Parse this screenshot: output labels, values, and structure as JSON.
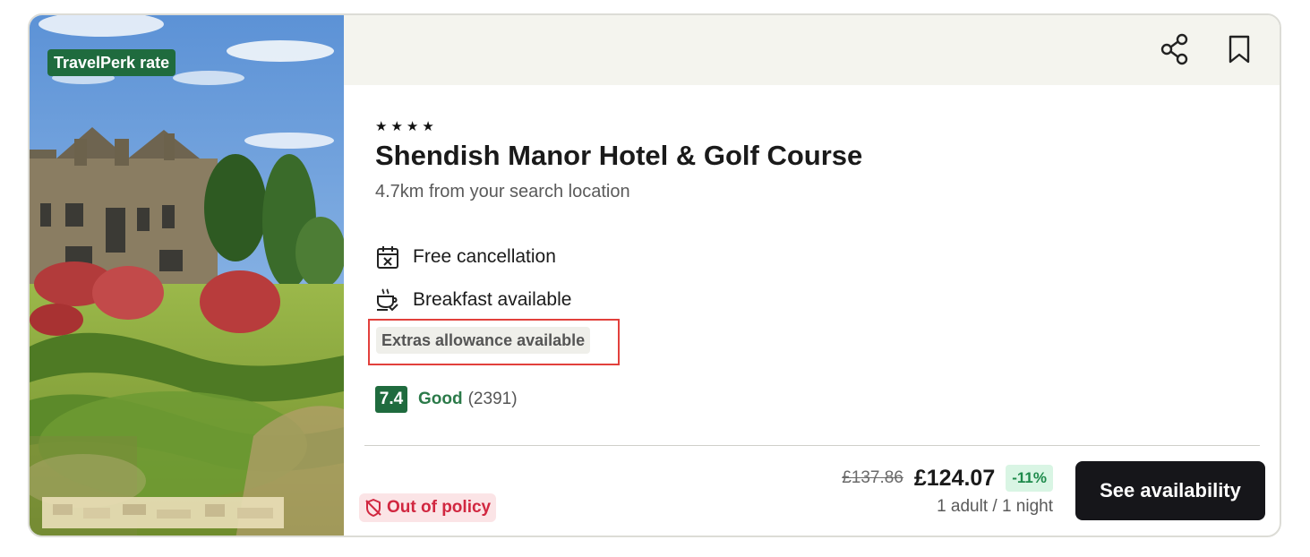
{
  "badge": {
    "rate_label": "TravelPerk rate"
  },
  "hotel": {
    "stars": "★★★★",
    "name": "Shendish Manor Hotel & Golf Course",
    "distance": "4.7km from your search location"
  },
  "features": [
    {
      "icon": "calendar-x-icon",
      "label": "Free cancellation"
    },
    {
      "icon": "coffee-cup-check-icon",
      "label": "Breakfast available"
    }
  ],
  "extras_tag": "Extras allowance available",
  "rating": {
    "score": "7.4",
    "verdict": "Good",
    "reviews": "(2391)"
  },
  "policy": {
    "icon": "shield-off-icon",
    "label": "Out of policy"
  },
  "price": {
    "original": "£137.86",
    "current": "£124.07",
    "discount": "-11%",
    "per": "1 adult / 1 night"
  },
  "actions": {
    "share_icon": "share-icon",
    "bookmark_icon": "bookmark-icon",
    "cta_label": "See availability"
  },
  "colors": {
    "brand_green": "#1f6b3e",
    "rating_green": "#2b7a49",
    "policy_red": "#d12740",
    "highlight_red": "#e2403c",
    "cta_black": "#16161a",
    "top_bar_bg": "#f4f4ee"
  }
}
